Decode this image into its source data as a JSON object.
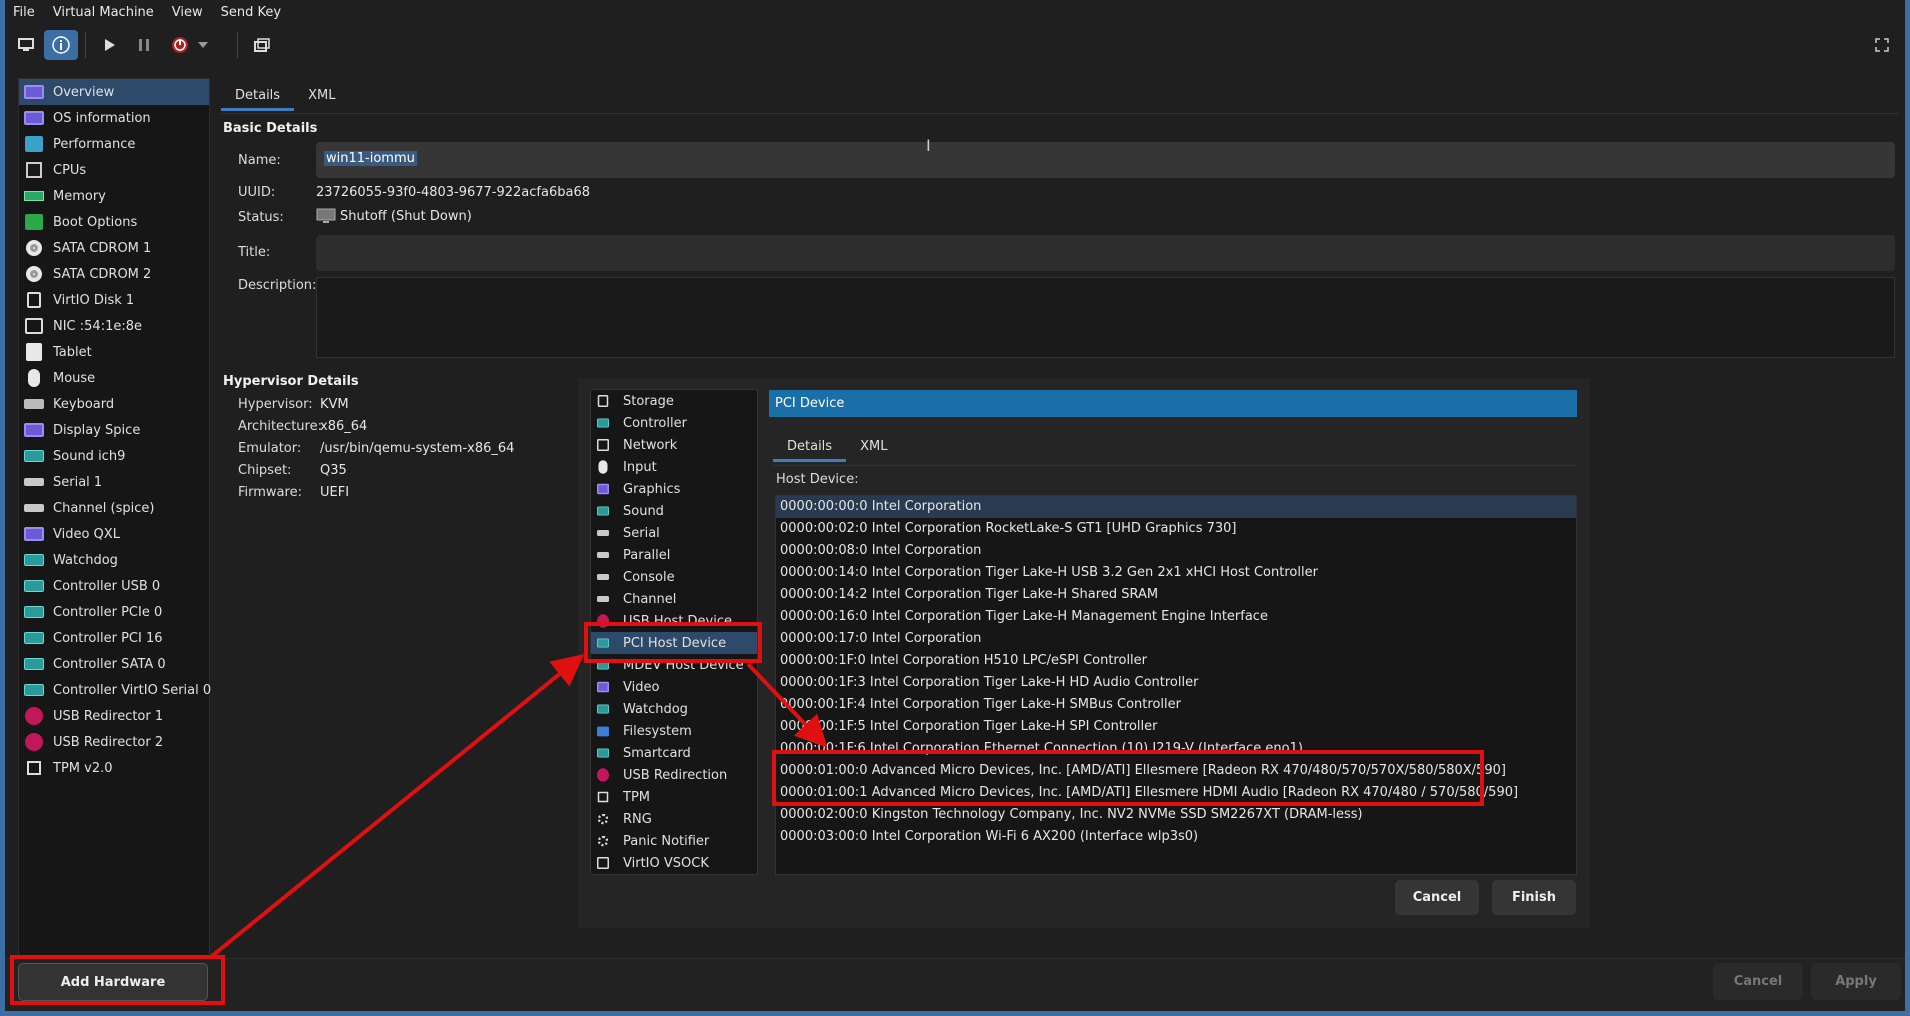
{
  "menubar": [
    "File",
    "Virtual Machine",
    "View",
    "Send Key"
  ],
  "toolbar": {
    "icons": [
      "monitor-icon",
      "info-icon",
      "play-icon",
      "pause-icon",
      "power-icon",
      "dropdown-arrow-icon",
      "clone-icon",
      "fullscreen-icon"
    ]
  },
  "sidebar": {
    "items": [
      {
        "label": "Overview",
        "icon": "screen"
      },
      {
        "label": "OS information",
        "icon": "screen"
      },
      {
        "label": "Performance",
        "icon": "chart"
      },
      {
        "label": "CPUs",
        "icon": "cpu"
      },
      {
        "label": "Memory",
        "icon": "mem"
      },
      {
        "label": "Boot Options",
        "icon": "boot"
      },
      {
        "label": "SATA CDROM 1",
        "icon": "disc"
      },
      {
        "label": "SATA CDROM 2",
        "icon": "disc"
      },
      {
        "label": "VirtIO Disk 1",
        "icon": "disk"
      },
      {
        "label": "NIC :54:1e:8e",
        "icon": "nic"
      },
      {
        "label": "Tablet",
        "icon": "tab"
      },
      {
        "label": "Mouse",
        "icon": "mouse"
      },
      {
        "label": "Keyboard",
        "icon": "kbd"
      },
      {
        "label": "Display Spice",
        "icon": "screen"
      },
      {
        "label": "Sound ich9",
        "icon": "card"
      },
      {
        "label": "Serial 1",
        "icon": "serial"
      },
      {
        "label": "Channel (spice)",
        "icon": "serial"
      },
      {
        "label": "Video QXL",
        "icon": "screen"
      },
      {
        "label": "Watchdog",
        "icon": "card"
      },
      {
        "label": "Controller USB 0",
        "icon": "card"
      },
      {
        "label": "Controller PCIe 0",
        "icon": "card"
      },
      {
        "label": "Controller PCI 16",
        "icon": "card"
      },
      {
        "label": "Controller SATA 0",
        "icon": "card"
      },
      {
        "label": "Controller VirtIO Serial 0",
        "icon": "card"
      },
      {
        "label": "USB Redirector 1",
        "icon": "usb"
      },
      {
        "label": "USB Redirector 2",
        "icon": "usb"
      },
      {
        "label": "TPM v2.0",
        "icon": "tpm"
      }
    ],
    "add_hardware": "Add Hardware"
  },
  "main": {
    "tabs": [
      "Details",
      "XML"
    ],
    "basic_title": "Basic Details",
    "name_label": "Name:",
    "name_value": "win11-iommu",
    "uuid_label": "UUID:",
    "uuid_value": "23726055-93f0-4803-9677-922acfa6ba68",
    "status_label": "Status:",
    "status_value": "Shutoff (Shut Down)",
    "title_label": "Title:",
    "description_label": "Description:",
    "hyper_title": "Hypervisor Details",
    "hypervisor_label": "Hypervisor:",
    "hypervisor_value": "KVM",
    "arch_label": "Architecture:",
    "arch_value": "x86_64",
    "emulator_label": "Emulator:",
    "emulator_value": "/usr/bin/qemu-system-x86_64",
    "chipset_label": "Chipset:",
    "chipset_value": "Q35",
    "firmware_label": "Firmware:",
    "firmware_value": "UEFI"
  },
  "dialog": {
    "hw_items": [
      {
        "label": "Storage",
        "icon": "disk"
      },
      {
        "label": "Controller",
        "icon": "card"
      },
      {
        "label": "Network",
        "icon": "nic"
      },
      {
        "label": "Input",
        "icon": "mouse"
      },
      {
        "label": "Graphics",
        "icon": "screen"
      },
      {
        "label": "Sound",
        "icon": "card"
      },
      {
        "label": "Serial",
        "icon": "serial"
      },
      {
        "label": "Parallel",
        "icon": "serial"
      },
      {
        "label": "Console",
        "icon": "serial"
      },
      {
        "label": "Channel",
        "icon": "serial"
      },
      {
        "label": "USB Host Device",
        "icon": "usb"
      },
      {
        "label": "PCI Host Device",
        "icon": "card"
      },
      {
        "label": "MDEV Host Device",
        "icon": "card"
      },
      {
        "label": "Video",
        "icon": "screen"
      },
      {
        "label": "Watchdog",
        "icon": "card"
      },
      {
        "label": "Filesystem",
        "icon": "folder"
      },
      {
        "label": "Smartcard",
        "icon": "card"
      },
      {
        "label": "USB Redirection",
        "icon": "usb"
      },
      {
        "label": "TPM",
        "icon": "tpm"
      },
      {
        "label": "RNG",
        "icon": "gear"
      },
      {
        "label": "Panic Notifier",
        "icon": "gear"
      },
      {
        "label": "VirtIO VSOCK",
        "icon": "nic"
      }
    ],
    "header": "PCI Device",
    "tabs": [
      "Details",
      "XML"
    ],
    "host_device_label": "Host Device:",
    "devices": [
      "0000:00:00:0 Intel Corporation",
      "0000:00:02:0 Intel Corporation RocketLake-S GT1 [UHD Graphics 730]",
      "0000:00:08:0 Intel Corporation",
      "0000:00:14:0 Intel Corporation Tiger Lake-H USB 3.2 Gen 2x1 xHCI Host Controller",
      "0000:00:14:2 Intel Corporation Tiger Lake-H Shared SRAM",
      "0000:00:16:0 Intel Corporation Tiger Lake-H Management Engine Interface",
      "0000:00:17:0 Intel Corporation",
      "0000:00:1F:0 Intel Corporation H510 LPC/eSPI Controller",
      "0000:00:1F:3 Intel Corporation Tiger Lake-H HD Audio Controller",
      "0000:00:1F:4 Intel Corporation Tiger Lake-H SMBus Controller",
      "0000:00:1F:5 Intel Corporation Tiger Lake-H SPI Controller",
      "0000:00:1F:6 Intel Corporation Ethernet Connection (10) I219-V (Interface eno1)",
      "0000:01:00:0 Advanced Micro Devices, Inc. [AMD/ATI] Ellesmere [Radeon RX 470/480/570/570X/580/580X/590]",
      "0000:01:00:1 Advanced Micro Devices, Inc. [AMD/ATI] Ellesmere HDMI Audio [Radeon RX 470/480 / 570/580/590]",
      "0000:02:00:0 Kingston Technology Company, Inc. NV2 NVMe SSD SM2267XT (DRAM-less)",
      "0000:03:00:0 Intel Corporation Wi-Fi 6 AX200 (Interface wlp3s0)"
    ],
    "cancel": "Cancel",
    "finish": "Finish"
  },
  "bottom": {
    "cancel": "Cancel",
    "apply": "Apply"
  },
  "colors": {
    "accent": "#1b6fa8",
    "selection": "#2d4a6b",
    "annotation": "#e01010"
  }
}
